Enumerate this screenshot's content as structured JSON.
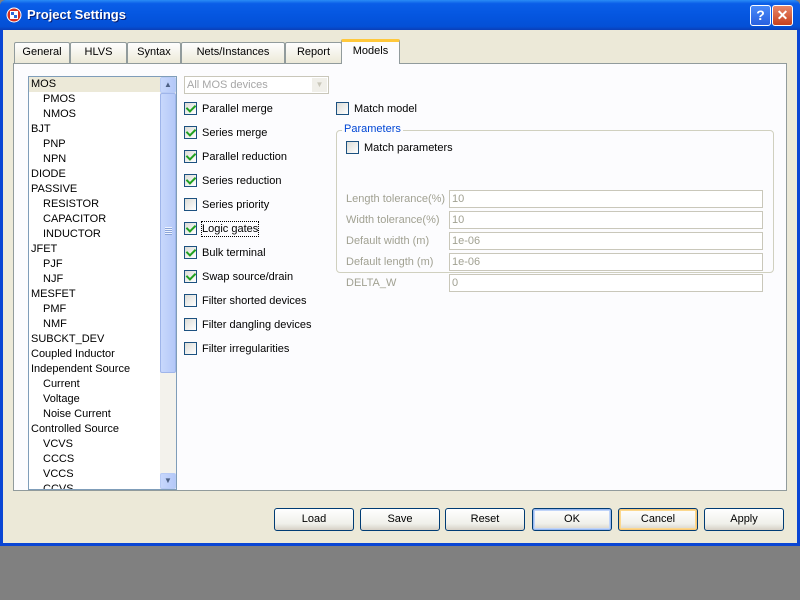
{
  "window": {
    "title": "Project Settings",
    "help_label": "?",
    "close_label": "✕"
  },
  "tabs": [
    {
      "label": "General"
    },
    {
      "label": "HLVS"
    },
    {
      "label": "Syntax"
    },
    {
      "label": "Nets/Instances"
    },
    {
      "label": "Report"
    },
    {
      "label": "Models",
      "active": true
    }
  ],
  "device_list": {
    "selected": "MOS",
    "items": [
      {
        "label": "MOS",
        "level": 0
      },
      {
        "label": "PMOS",
        "level": 1
      },
      {
        "label": "NMOS",
        "level": 1
      },
      {
        "label": "BJT",
        "level": 0
      },
      {
        "label": "PNP",
        "level": 1
      },
      {
        "label": "NPN",
        "level": 1
      },
      {
        "label": "DIODE",
        "level": 0
      },
      {
        "label": "PASSIVE",
        "level": 0
      },
      {
        "label": "RESISTOR",
        "level": 1
      },
      {
        "label": "CAPACITOR",
        "level": 1
      },
      {
        "label": "INDUCTOR",
        "level": 1
      },
      {
        "label": "JFET",
        "level": 0
      },
      {
        "label": "PJF",
        "level": 1
      },
      {
        "label": "NJF",
        "level": 1
      },
      {
        "label": "MESFET",
        "level": 0
      },
      {
        "label": "PMF",
        "level": 1
      },
      {
        "label": "NMF",
        "level": 1
      },
      {
        "label": "SUBCKT_DEV",
        "level": 0
      },
      {
        "label": "Coupled Inductor",
        "level": 0
      },
      {
        "label": "Independent Source",
        "level": 0
      },
      {
        "label": "Current",
        "level": 1
      },
      {
        "label": "Voltage",
        "level": 1
      },
      {
        "label": "Noise Current",
        "level": 1
      },
      {
        "label": "Controlled Source",
        "level": 0
      },
      {
        "label": "VCVS",
        "level": 1
      },
      {
        "label": "CCCS",
        "level": 1
      },
      {
        "label": "VCCS",
        "level": 1
      },
      {
        "label": "CCVS",
        "level": 1
      }
    ],
    "scroll_up_icon": "▲",
    "scroll_down_icon": "▼"
  },
  "device_filter": {
    "value": "All MOS devices",
    "arrow_icon": "▼"
  },
  "options": [
    {
      "label": "Parallel merge",
      "checked": true
    },
    {
      "label": "Series merge",
      "checked": true
    },
    {
      "label": "Parallel reduction",
      "checked": true
    },
    {
      "label": "Series reduction",
      "checked": true
    },
    {
      "label": "Series priority",
      "checked": false
    },
    {
      "label": "Logic gates",
      "checked": true,
      "focused": true
    },
    {
      "label": "Bulk terminal",
      "checked": true
    },
    {
      "label": "Swap source/drain",
      "checked": true
    },
    {
      "label": "Filter shorted devices",
      "checked": false
    },
    {
      "label": "Filter dangling devices",
      "checked": false
    },
    {
      "label": "Filter irregularities",
      "checked": false
    }
  ],
  "match_model": {
    "label": "Match model",
    "checked": false
  },
  "parameters": {
    "title": "Parameters",
    "match_parameters": {
      "label": "Match parameters",
      "checked": false
    },
    "fields": [
      {
        "label": "Length tolerance(%)",
        "value": "10"
      },
      {
        "label": "Width tolerance(%)",
        "value": "10"
      },
      {
        "label": "Default width (m)",
        "value": "1e-06"
      },
      {
        "label": "Default length (m)",
        "value": "1e-06"
      },
      {
        "label": "DELTA_W",
        "value": "0"
      }
    ]
  },
  "buttons": {
    "load": "Load",
    "save": "Save",
    "reset": "Reset",
    "ok": "OK",
    "cancel": "Cancel",
    "apply": "Apply"
  },
  "colors": {
    "titlebar": "#0556e0",
    "face": "#ece9d8",
    "group_title": "#0046d5",
    "check": "#21a121"
  }
}
